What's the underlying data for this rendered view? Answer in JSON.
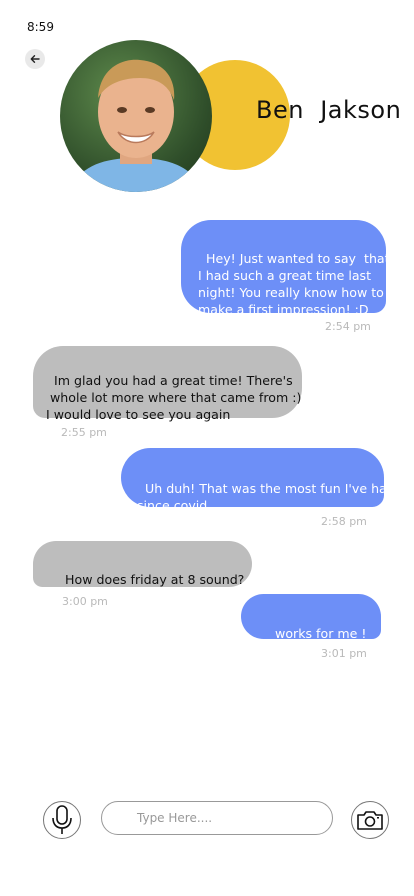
{
  "status_bar": {
    "time": "8:59"
  },
  "header": {
    "contact_name": "Ben  Jakson",
    "accent_color": "#f1c232"
  },
  "messages": [
    {
      "direction": "out",
      "text": "Hey! Just wanted to say  that\nI had such a great time last\nnight! You really know how to\nmake a first impression! :D",
      "time": "2:54 pm"
    },
    {
      "direction": "in",
      "text": "Im glad you had a great time! There's\n whole lot more where that came from :)\nI would love to see you again",
      "time": "2:55 pm"
    },
    {
      "direction": "out",
      "text": "Uh duh! That was the most fun I've had\nsince covid",
      "time": "2:58 pm"
    },
    {
      "direction": "in",
      "text": "How does friday at 8 sound?",
      "time": "3:00 pm"
    },
    {
      "direction": "out",
      "text": "works for me !",
      "time": "3:01 pm"
    }
  ],
  "composer": {
    "placeholder": "Type Here...."
  },
  "colors": {
    "outgoing_bubble": "#6d8ff7",
    "incoming_bubble": "#bdbdbd",
    "timestamp": "#b9b9b9"
  },
  "icons": {
    "back": "arrow-left-icon",
    "mic": "microphone-icon",
    "camera": "camera-icon"
  }
}
